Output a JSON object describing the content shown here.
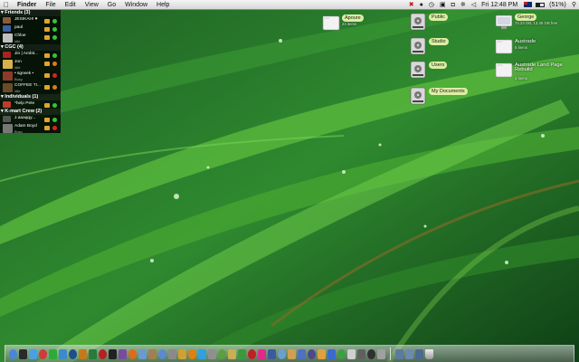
{
  "menubar": {
    "apple_icon": "apple-icon",
    "app_name": "Finder",
    "menus": [
      "File",
      "Edit",
      "View",
      "Go",
      "Window",
      "Help"
    ],
    "clock": "Fri 12:48 PM",
    "battery_text": "(51%)",
    "battery_level": 0.51
  },
  "buddylist": {
    "groups": [
      {
        "name": "Friends (3)",
        "buddies": [
          {
            "name": "JESIKAH! ♥",
            "status": "",
            "color": "#8a5a3c",
            "presence": "#37c43a"
          },
          {
            "name": "paul",
            "status": "",
            "color": "#3b5fa0",
            "presence": "#37c43a"
          },
          {
            "name": "Chloe",
            "status": "Idle",
            "color": "#c0c0c0",
            "presence": "#37c43a"
          }
        ]
      },
      {
        "name": "CGC (4)",
        "buddies": [
          {
            "name": "Jin | Ambit...",
            "status": "",
            "color": "#aa2222",
            "presence": "#37c43a"
          },
          {
            "name": "Jon",
            "status": "Idle",
            "color": "#d8b04c",
            "presence": "#e07a1f"
          },
          {
            "name": "• sgrwek •",
            "status": "Busy",
            "color": "#8c3b2a",
            "presence": "#d6261f"
          },
          {
            "name": "COFFEE TI...",
            "status": "Idle",
            "color": "#6b4a2a",
            "presence": "#e07a1f"
          }
        ]
      },
      {
        "name": "Individuals (1)",
        "buddies": [
          {
            "name": "*help Pete",
            "status": "",
            "color": "#c13a2c",
            "presence": "#37c43a"
          }
        ]
      },
      {
        "name": "K-mart Crew (2)",
        "buddies": [
          {
            "name": "J.aaaqqy...",
            "status": "",
            "color": "#555555",
            "presence": "#37c43a"
          },
          {
            "name": "Adam Boyd",
            "status": "Busy",
            "color": "#777777",
            "presence": "#d6261f"
          }
        ]
      }
    ]
  },
  "desktop": {
    "icons": [
      {
        "label": "Apoure",
        "sub": "24 items",
        "sub2": "",
        "kind": "folder",
        "style": "highlight"
      },
      {
        "label": "Public",
        "sub": "",
        "sub2": "",
        "kind": "disk",
        "style": "highlight"
      },
      {
        "label": "Studio",
        "sub": "",
        "sub2": "",
        "kind": "disk",
        "style": "highlight"
      },
      {
        "label": "Users",
        "sub": "",
        "sub2": "",
        "kind": "disk",
        "style": "highlight"
      },
      {
        "label": "My Documents",
        "sub": "",
        "sub2": "",
        "kind": "disk",
        "style": "highlight"
      },
      {
        "label": "George",
        "sub": "74.23 GB, 13.26 GB free",
        "sub2": "",
        "kind": "monitor",
        "style": "highlight"
      },
      {
        "label": "Austrade",
        "sub": "5 items",
        "sub2": "",
        "kind": "folder",
        "style": "plain"
      },
      {
        "label": "Austrade Land Page",
        "sub": "Rebuild",
        "sub2": "4 items",
        "kind": "folder",
        "style": "plain"
      }
    ]
  },
  "dock": {
    "apps": [
      {
        "name": "finder",
        "color": "#4a86d8"
      },
      {
        "name": "dashboard",
        "color": "#2a2a2a"
      },
      {
        "name": "safari",
        "color": "#4aa0e0"
      },
      {
        "name": "ical",
        "color": "#d23a3a"
      },
      {
        "name": "adium",
        "color": "#2eaa3a"
      },
      {
        "name": "itunes",
        "color": "#3a8ad0"
      },
      {
        "name": "photoshop",
        "color": "#1f4f8a"
      },
      {
        "name": "illustrator",
        "color": "#c47a1a"
      },
      {
        "name": "dreamweaver",
        "color": "#2a7a3a"
      },
      {
        "name": "flash",
        "color": "#b62020"
      },
      {
        "name": "terminal",
        "color": "#222222"
      },
      {
        "name": "textmate",
        "color": "#7a4aa0"
      },
      {
        "name": "firefox",
        "color": "#e06a1a"
      },
      {
        "name": "mail",
        "color": "#6a9ad0"
      },
      {
        "name": "address-book",
        "color": "#a08050"
      },
      {
        "name": "preview",
        "color": "#5a8ad0"
      },
      {
        "name": "system-preferences",
        "color": "#8a8a8a"
      },
      {
        "name": "transmit",
        "color": "#d0a030"
      },
      {
        "name": "vlc",
        "color": "#e08010"
      },
      {
        "name": "skype",
        "color": "#30a0e0"
      },
      {
        "name": "fontbook",
        "color": "#909090"
      },
      {
        "name": "coda",
        "color": "#5aa040"
      },
      {
        "name": "cyberduck",
        "color": "#c8b050"
      },
      {
        "name": "chrome",
        "color": "#3a9a3a"
      },
      {
        "name": "opera",
        "color": "#c02020"
      },
      {
        "name": "flickr",
        "color": "#e02a8a"
      },
      {
        "name": "quicktime",
        "color": "#3a5aa0"
      },
      {
        "name": "iphoto",
        "color": "#6aa0d0"
      },
      {
        "name": "garageband",
        "color": "#d0a050"
      },
      {
        "name": "imovie",
        "color": "#5070c0"
      },
      {
        "name": "idvd",
        "color": "#4a4a8a"
      },
      {
        "name": "pages",
        "color": "#e0a040"
      },
      {
        "name": "keynote",
        "color": "#3a6ad0"
      },
      {
        "name": "numbers",
        "color": "#3aa040"
      },
      {
        "name": "textedit",
        "color": "#d0d0d0"
      },
      {
        "name": "calculator",
        "color": "#606060"
      },
      {
        "name": "activity-monitor",
        "color": "#303030"
      },
      {
        "name": "disk-utility",
        "color": "#a0a0a0"
      }
    ],
    "stacks": [
      {
        "name": "applications-stack",
        "color": "#5a7aa0"
      },
      {
        "name": "documents-stack",
        "color": "#6a8ab0"
      },
      {
        "name": "downloads-stack",
        "color": "#4a6a90"
      }
    ]
  }
}
